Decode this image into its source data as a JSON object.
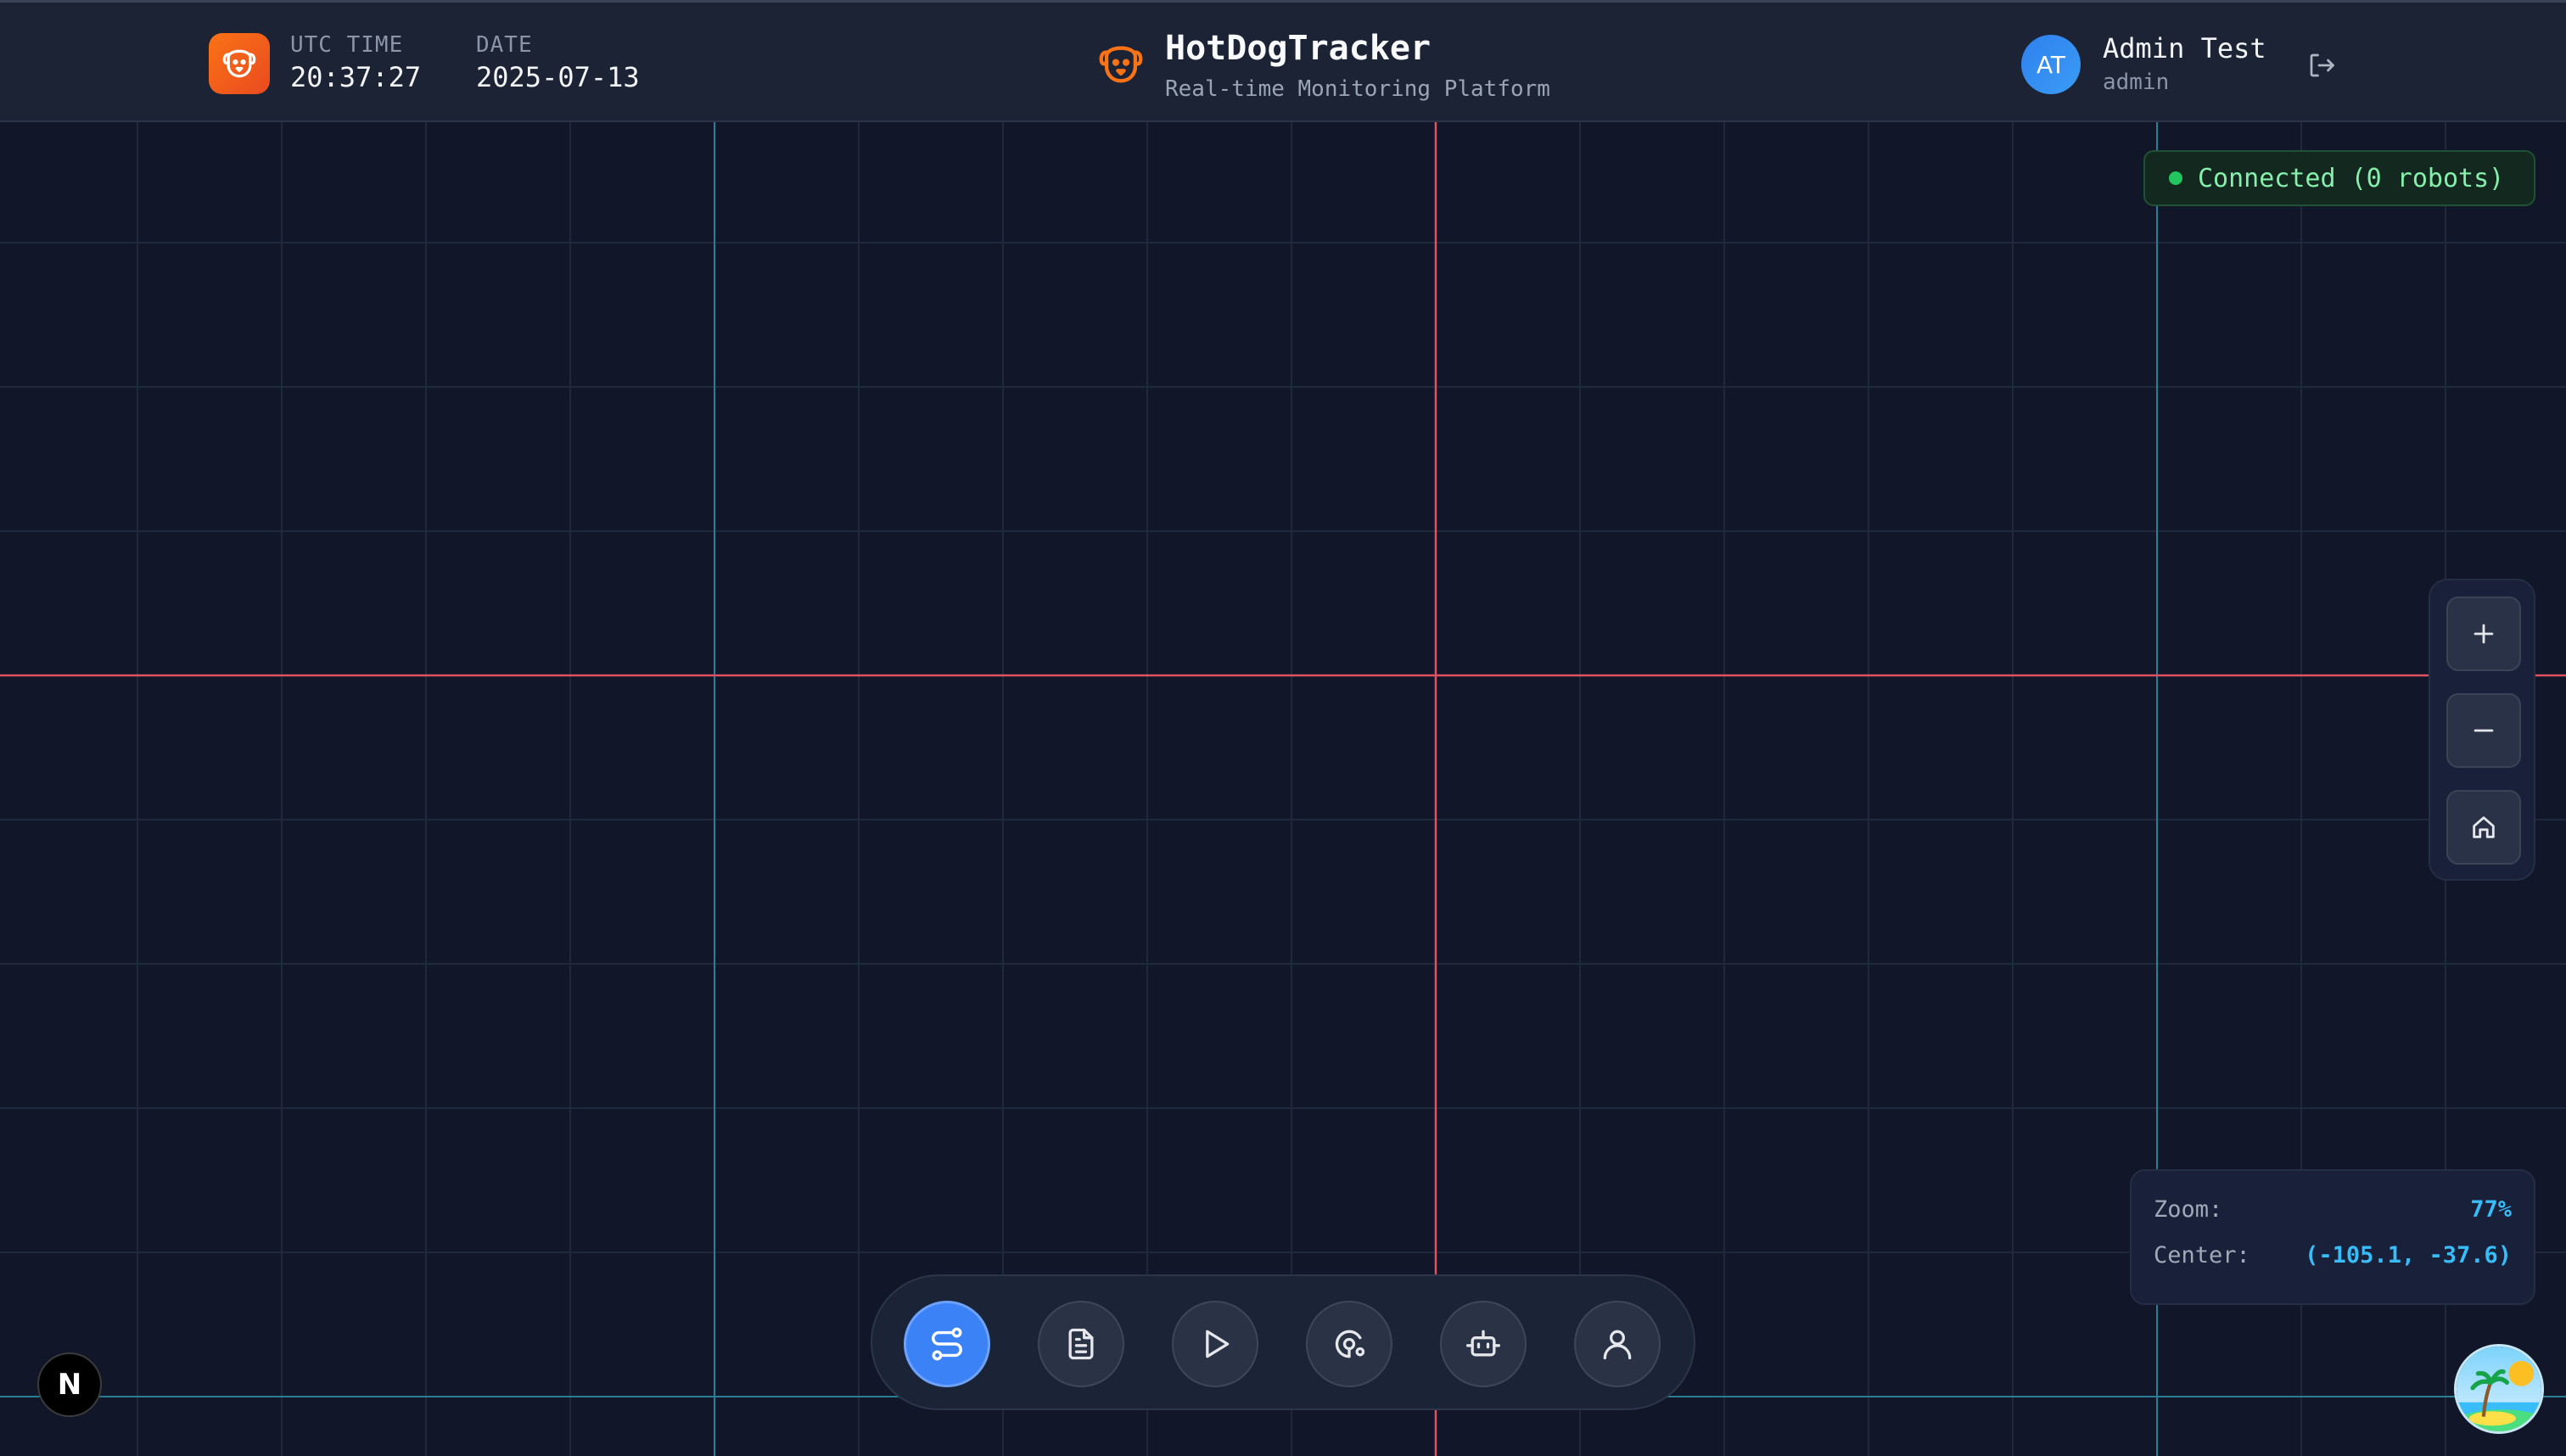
{
  "header": {
    "utc_label": "UTC TIME",
    "utc_value": "20:37:27",
    "date_label": "DATE",
    "date_value": "2025-07-13",
    "brand_title": "HotDogTracker",
    "brand_subtitle": "Real-time Monitoring Platform",
    "user_initials": "AT",
    "user_name": "Admin Test",
    "user_role": "admin",
    "app_icon": "dog-icon",
    "logout_icon": "logout-icon"
  },
  "status": {
    "text": "Connected (0 robots)",
    "color": "#22c55e"
  },
  "zoom_controls": {
    "zoom_in_icon": "plus-icon",
    "zoom_out_icon": "minus-icon",
    "home_icon": "home-icon"
  },
  "info": {
    "zoom_label": "Zoom:",
    "zoom_value": "77%",
    "center_label": "Center:",
    "center_value": "(-105.1, -37.6)"
  },
  "toolbar": {
    "items": [
      {
        "icon": "route-icon",
        "active": true
      },
      {
        "icon": "document-icon",
        "active": false
      },
      {
        "icon": "play-icon",
        "active": false
      },
      {
        "icon": "tracking-icon",
        "active": false
      },
      {
        "icon": "robot-icon",
        "active": false
      },
      {
        "icon": "user-icon",
        "active": false
      }
    ]
  },
  "colors": {
    "background": "#111729",
    "grid_line": "#1e2a3c",
    "axis_x": "#e05262",
    "axis_y": "#e05262",
    "major_line": "#2a7d95",
    "accent": "#3b82f6"
  },
  "badges": {
    "framework_letter": "N"
  }
}
